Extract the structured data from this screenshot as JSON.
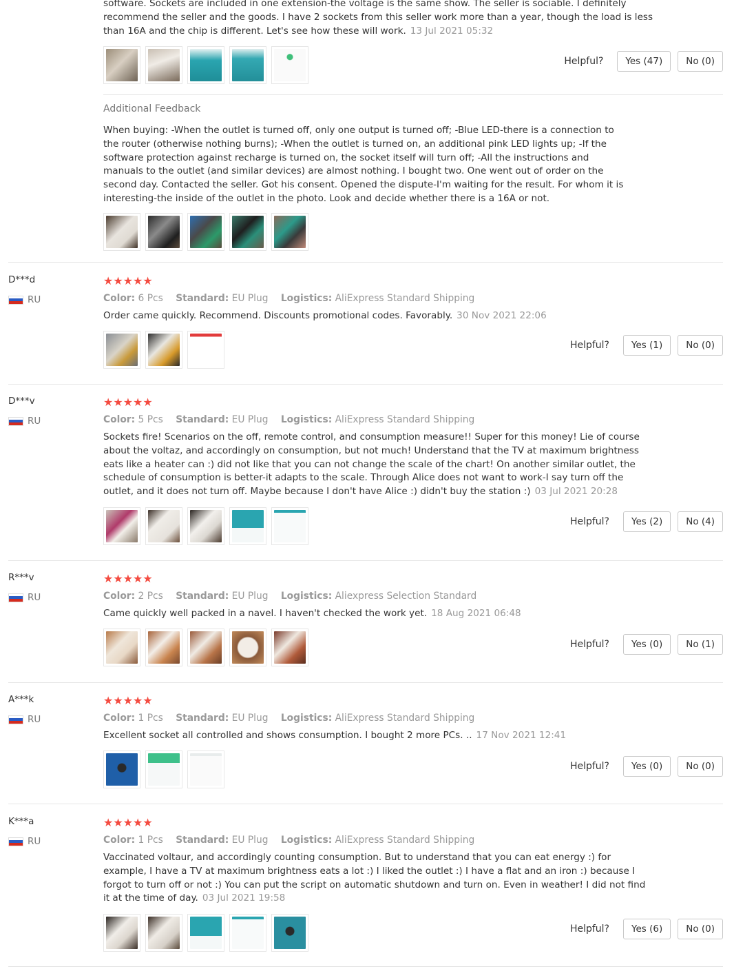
{
  "top_review": {
    "text_lines": [
      "software. Sockets are included in one extension-the voltage is the same show. The seller is sociable. I definitely",
      "recommend the seller and the goods. I have 2 sockets from this seller work more than a year, though the load is less",
      "than 16A and the chip is different. Let's see how these will work."
    ],
    "date": "13 Jul 2021 05:32",
    "helpful_label": "Helpful?",
    "yes_label": "Yes (47)",
    "no_label": "No (0)"
  },
  "additional": {
    "title": "Additional Feedback",
    "text": "When buying: -When the outlet is turned off, only one output is turned off; -Blue LED-there is a connection to the router (otherwise nothing burns); -When the outlet is turned on, an additional pink LED lights up; -If the software protection against recharge is turned on, the socket itself will turn off; -All the instructions and manuals to the outlet (and similar devices) are almost nothing. I bought two. One went out of order on the second day. Contacted the seller. Got his consent. Opened the dispute-I'm waiting for the result. For whom it is interesting-the inside of the outlet in the photo. Look and decide whether there is a 16A or not."
  },
  "labels": {
    "color": "Color:",
    "standard": "Standard:",
    "logistics": "Logistics:",
    "helpful": "Helpful?"
  },
  "reviews": [
    {
      "name": "D***d",
      "country": "RU",
      "stars": "★★★★★",
      "color": "6 Pcs",
      "standard": "EU Plug",
      "logistics": "AliExpress Standard Shipping",
      "text": "Order came quickly. Recommend. Discounts promotional codes. Favorably.",
      "date": "30 Nov 2021 22:06",
      "yes": "Yes (1)",
      "no": "No (0)"
    },
    {
      "name": "D***v",
      "country": "RU",
      "stars": "★★★★★",
      "color": "5 Pcs",
      "standard": "EU Plug",
      "logistics": "AliExpress Standard Shipping",
      "text": "Sockets fire! Scenarios on the off, remote control, and consumption measure!! Super for this money! Lie of course about the voltaz, and accordingly on consumption, but not much! Understand that the TV at maximum brightness eats like a heater can :) did not like that you can not change the scale of the chart! On another similar outlet, the schedule of consumption is better-it adapts to the scale. Through Alice does not want to work-I say turn off the outlet, and it does not turn off. Maybe because I don't have Alice :) didn't buy the station :)",
      "date": "03 Jul 2021 20:28",
      "yes": "Yes (2)",
      "no": "No (4)"
    },
    {
      "name": "R***v",
      "country": "RU",
      "stars": "★★★★★",
      "color": "2 Pcs",
      "standard": "EU Plug",
      "logistics": "Aliexpress Selection Standard",
      "text": "Came quickly well packed in a navel. I haven't checked the work yet.",
      "date": "18 Aug 2021 06:48",
      "yes": "Yes (0)",
      "no": "No (1)"
    },
    {
      "name": "A***k",
      "country": "RU",
      "stars": "★★★★★",
      "color": "1 Pcs",
      "standard": "EU Plug",
      "logistics": "AliExpress Standard Shipping",
      "text": "Excellent socket all controlled and shows consumption. I bought 2 more PCs. ..",
      "date": "17 Nov 2021 12:41",
      "yes": "Yes (0)",
      "no": "No (0)"
    },
    {
      "name": "K***a",
      "country": "RU",
      "stars": "★★★★★",
      "color": "1 Pcs",
      "standard": "EU Plug",
      "logistics": "AliExpress Standard Shipping",
      "text": "Vaccinated voltaur, and accordingly counting consumption. But to understand that you can eat energy :) for example, I have a TV at maximum brightness eats a lot :) I liked the outlet :) I have a flat and an iron :) because I forgot to turn off or not :) You can put the script on automatic shutdown and turn on. Even in weather! I did not find it at the time of day.",
      "date": "03 Jul 2021 19:58",
      "yes": "Yes (6)",
      "no": "No (0)"
    }
  ],
  "colors": {
    "star": "#f44b40",
    "muted": "#999999",
    "divider": "#e5e5e5"
  }
}
